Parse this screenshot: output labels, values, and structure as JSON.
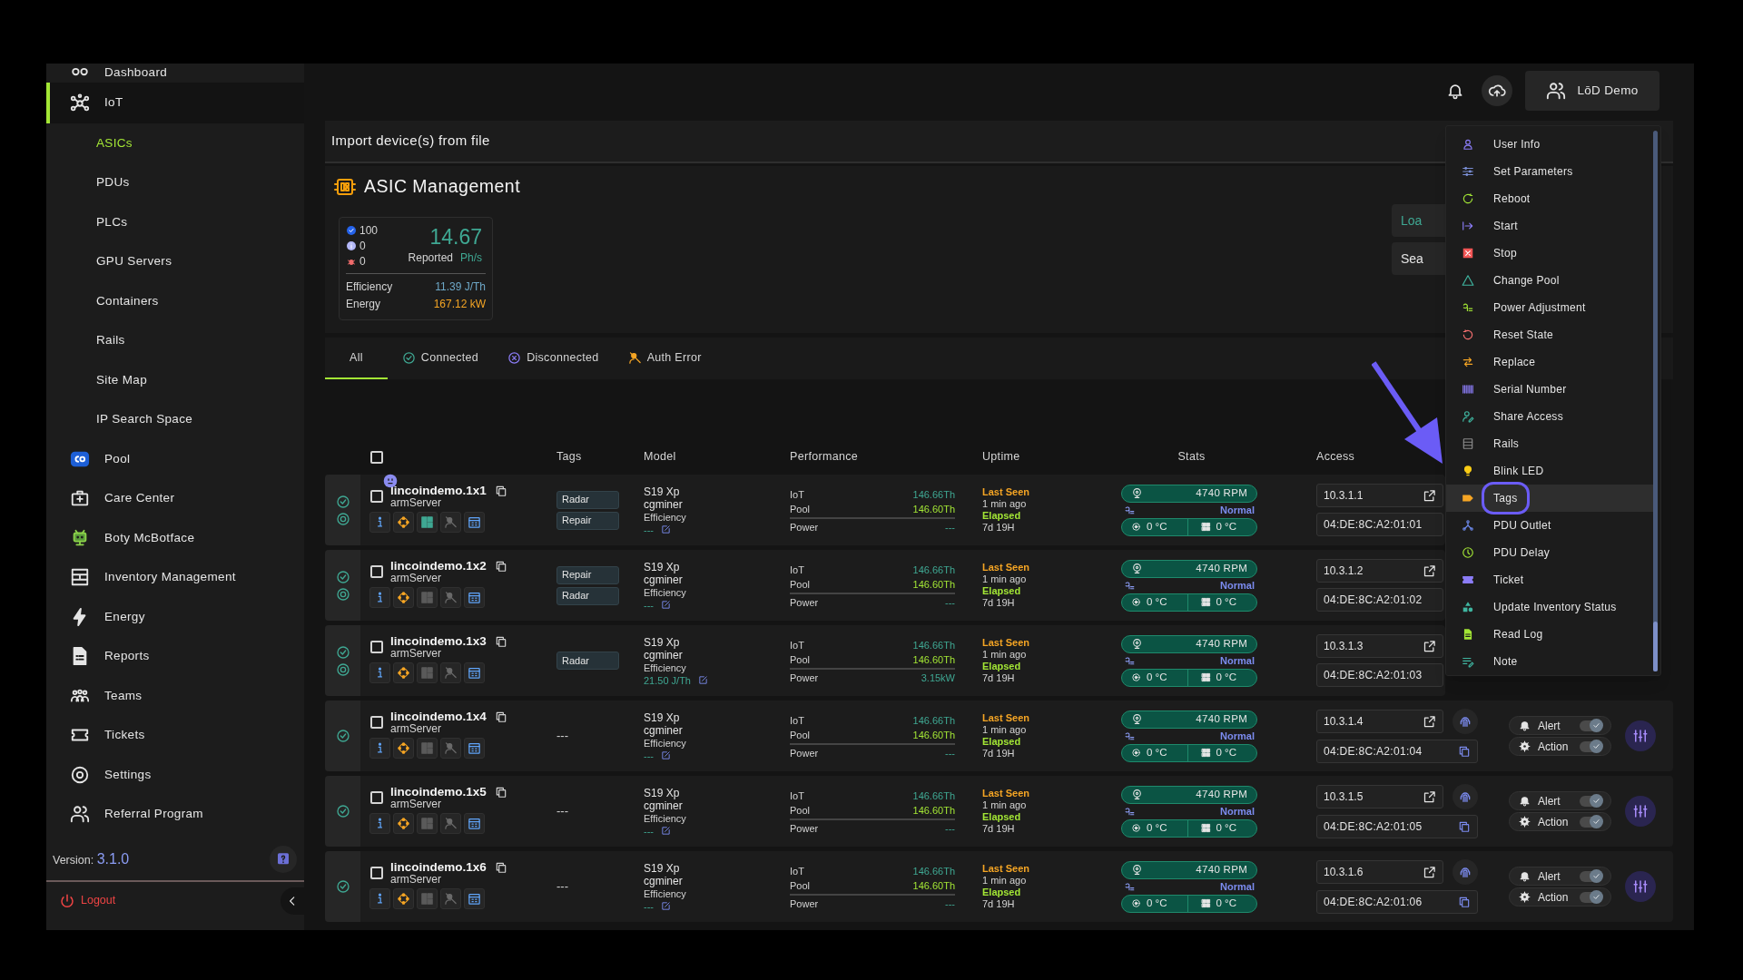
{
  "sidebar": {
    "items": [
      {
        "label": "Dashboard",
        "selected": false
      },
      {
        "label": "IoT",
        "selected": true,
        "expanded": true,
        "children": [
          {
            "label": "ASICs",
            "selected": true
          },
          {
            "label": "PDUs",
            "selected": false
          },
          {
            "label": "PLCs",
            "selected": false
          },
          {
            "label": "GPU Servers",
            "selected": false
          },
          {
            "label": "Containers",
            "selected": false
          },
          {
            "label": "Rails",
            "selected": false
          },
          {
            "label": "Site Map",
            "selected": false
          },
          {
            "label": "IP Search Space",
            "selected": false
          }
        ]
      },
      {
        "label": "Pool",
        "selected": false
      },
      {
        "label": "Care Center",
        "selected": false
      },
      {
        "label": "Boty McBotface",
        "selected": false
      },
      {
        "label": "Inventory Management",
        "selected": false
      },
      {
        "label": "Energy",
        "selected": false
      },
      {
        "label": "Reports",
        "selected": false
      },
      {
        "label": "Teams",
        "selected": false
      },
      {
        "label": "Tickets",
        "selected": false
      },
      {
        "label": "Settings",
        "selected": false
      },
      {
        "label": "Referral Program",
        "selected": false
      }
    ],
    "version_label": "Version:",
    "version": "3.1.0",
    "logout": "Logout"
  },
  "header": {
    "user": "LōD Demo"
  },
  "import_bar": {
    "title": "Import device(s) from file"
  },
  "page": {
    "title": "ASIC Management",
    "buttons": [
      "Loa",
      "Sea"
    ]
  },
  "summary": {
    "counts": [
      {
        "kind": "ok",
        "value": "100"
      },
      {
        "kind": "info",
        "value": "0"
      },
      {
        "kind": "bug",
        "value": "0"
      }
    ],
    "hashrate": "14.67",
    "hashrate_label": "Reported",
    "hashrate_unit": "Ph/s",
    "efficiency_label": "Efficiency",
    "efficiency": "11.39 J/Th",
    "energy_label": "Energy",
    "energy": "167.12 kW"
  },
  "tabs": [
    {
      "label": "All",
      "kind": "all",
      "selected": true
    },
    {
      "label": "Connected",
      "kind": "connected",
      "selected": false
    },
    {
      "label": "Disconnected",
      "kind": "disconnected",
      "selected": false
    },
    {
      "label": "Auth Error",
      "kind": "auth",
      "selected": false
    }
  ],
  "table": {
    "columns": [
      "Tags",
      "Model",
      "Performance",
      "Uptime",
      "Stats",
      "Access"
    ],
    "select_all": false,
    "rows": [
      {
        "name": "lincoindemo.1x1",
        "host": "armServer",
        "checked": false,
        "connected": true,
        "tracking": true,
        "outlet_badge": true,
        "panel_on": true,
        "tags": [
          "Radar",
          "Repair"
        ],
        "model": "S19 Xp",
        "miner": "cgminer",
        "efficiency_label": "Efficiency",
        "efficiency": "---",
        "performance": [
          {
            "label": "IoT",
            "value": "146.66Th"
          },
          {
            "label": "Pool",
            "value": "146.60Th"
          },
          {
            "label": "Power",
            "value": "---"
          }
        ],
        "uptime": [
          {
            "label": "Last Seen",
            "value": "1 min ago"
          },
          {
            "label": "Elapsed",
            "value": "7d 19H"
          }
        ],
        "fan": "4740 RPM",
        "mode": "Normal",
        "chip_temp": "0 °C",
        "board_temp": "0 °C",
        "ip": "10.3.1.1",
        "mac": "04:DE:8C:A2:01:01"
      },
      {
        "name": "lincoindemo.1x2",
        "host": "armServer",
        "checked": false,
        "connected": true,
        "tracking": true,
        "outlet_badge": false,
        "panel_on": false,
        "tags": [
          "Repair",
          "Radar"
        ],
        "model": "S19 Xp",
        "miner": "cgminer",
        "efficiency_label": "Efficiency",
        "efficiency": "---",
        "performance": [
          {
            "label": "IoT",
            "value": "146.66Th"
          },
          {
            "label": "Pool",
            "value": "146.60Th"
          },
          {
            "label": "Power",
            "value": "---"
          }
        ],
        "uptime": [
          {
            "label": "Last Seen",
            "value": "1 min ago"
          },
          {
            "label": "Elapsed",
            "value": "7d 19H"
          }
        ],
        "fan": "4740 RPM",
        "mode": "Normal",
        "chip_temp": "0 °C",
        "board_temp": "0 °C",
        "ip": "10.3.1.2",
        "mac": "04:DE:8C:A2:01:02"
      },
      {
        "name": "lincoindemo.1x3",
        "host": "armServer",
        "checked": false,
        "connected": true,
        "tracking": true,
        "outlet_badge": false,
        "panel_on": false,
        "tags": [
          "Radar"
        ],
        "model": "S19 Xp",
        "miner": "cgminer",
        "efficiency_label": "Efficiency",
        "efficiency": "21.50 J/Th",
        "performance": [
          {
            "label": "IoT",
            "value": "146.66Th"
          },
          {
            "label": "Pool",
            "value": "146.60Th"
          },
          {
            "label": "Power",
            "value": "3.15kW"
          }
        ],
        "uptime": [
          {
            "label": "Last Seen",
            "value": "1 min ago"
          },
          {
            "label": "Elapsed",
            "value": "7d 19H"
          }
        ],
        "fan": "4740 RPM",
        "mode": "Normal",
        "chip_temp": "0 °C",
        "board_temp": "0 °C",
        "ip": "10.3.1.3",
        "mac": "04:DE:8C:A2:01:03"
      },
      {
        "name": "lincoindemo.1x4",
        "host": "armServer",
        "checked": false,
        "connected": true,
        "tracking": false,
        "outlet_badge": false,
        "panel_on": false,
        "no_tags": "---",
        "model": "S19 Xp",
        "miner": "cgminer",
        "efficiency_label": "Efficiency",
        "efficiency": "---",
        "performance": [
          {
            "label": "IoT",
            "value": "146.66Th"
          },
          {
            "label": "Pool",
            "value": "146.60Th"
          },
          {
            "label": "Power",
            "value": "---"
          }
        ],
        "uptime": [
          {
            "label": "Last Seen",
            "value": "1 min ago"
          },
          {
            "label": "Elapsed",
            "value": "7d 19H"
          }
        ],
        "fan": "4740 RPM",
        "mode": "Normal",
        "chip_temp": "0 °C",
        "board_temp": "0 °C",
        "ip": "10.3.1.4",
        "mac": "04:DE:8C:A2:01:04",
        "alert": {
          "label": "Alert",
          "on": true
        },
        "action": {
          "label": "Action",
          "on": true
        }
      },
      {
        "name": "lincoindemo.1x5",
        "host": "armServer",
        "checked": false,
        "connected": true,
        "tracking": false,
        "outlet_badge": false,
        "panel_on": false,
        "no_tags": "---",
        "model": "S19 Xp",
        "miner": "cgminer",
        "efficiency_label": "Efficiency",
        "efficiency": "---",
        "performance": [
          {
            "label": "IoT",
            "value": "146.66Th"
          },
          {
            "label": "Pool",
            "value": "146.60Th"
          },
          {
            "label": "Power",
            "value": "---"
          }
        ],
        "uptime": [
          {
            "label": "Last Seen",
            "value": "1 min ago"
          },
          {
            "label": "Elapsed",
            "value": "7d 19H"
          }
        ],
        "fan": "4740 RPM",
        "mode": "Normal",
        "chip_temp": "0 °C",
        "board_temp": "0 °C",
        "ip": "10.3.1.5",
        "mac": "04:DE:8C:A2:01:05",
        "alert": {
          "label": "Alert",
          "on": true
        },
        "action": {
          "label": "Action",
          "on": true
        }
      },
      {
        "name": "lincoindemo.1x6",
        "host": "armServer",
        "checked": false,
        "connected": true,
        "tracking": false,
        "outlet_badge": false,
        "panel_on": false,
        "no_tags": "---",
        "model": "S19 Xp",
        "miner": "cgminer",
        "efficiency_label": "Efficiency",
        "efficiency": "---",
        "performance": [
          {
            "label": "IoT",
            "value": "146.66Th"
          },
          {
            "label": "Pool",
            "value": "146.60Th"
          },
          {
            "label": "Power",
            "value": "---"
          }
        ],
        "uptime": [
          {
            "label": "Last Seen",
            "value": "1 min ago"
          },
          {
            "label": "Elapsed",
            "value": "7d 19H"
          }
        ],
        "fan": "4740 RPM",
        "mode": "Normal",
        "chip_temp": "0 °C",
        "board_temp": "0 °C",
        "ip": "10.3.1.6",
        "mac": "04:DE:8C:A2:01:06",
        "alert": {
          "label": "Alert",
          "on": true
        },
        "action": {
          "label": "Action",
          "on": true
        }
      }
    ]
  },
  "context_menu": {
    "items": [
      {
        "label": "User Info",
        "selected": false
      },
      {
        "label": "Set Parameters",
        "selected": false
      },
      {
        "label": "Reboot",
        "selected": false
      },
      {
        "label": "Start",
        "selected": false
      },
      {
        "label": "Stop",
        "selected": false
      },
      {
        "label": "Change Pool",
        "selected": false
      },
      {
        "label": "Power Adjustment",
        "selected": false
      },
      {
        "label": "Reset State",
        "selected": false
      },
      {
        "label": "Replace",
        "selected": false
      },
      {
        "label": "Serial Number",
        "selected": false
      },
      {
        "label": "Share Access",
        "selected": false
      },
      {
        "label": "Rails",
        "selected": false
      },
      {
        "label": "Blink LED",
        "selected": false
      },
      {
        "label": "Tags",
        "selected": true
      },
      {
        "label": "PDU Outlet",
        "selected": false
      },
      {
        "label": "PDU Delay",
        "selected": false
      },
      {
        "label": "Ticket",
        "selected": false
      },
      {
        "label": "Update Inventory Status",
        "selected": false
      },
      {
        "label": "Read Log",
        "selected": false
      },
      {
        "label": "Note",
        "selected": false
      }
    ]
  }
}
